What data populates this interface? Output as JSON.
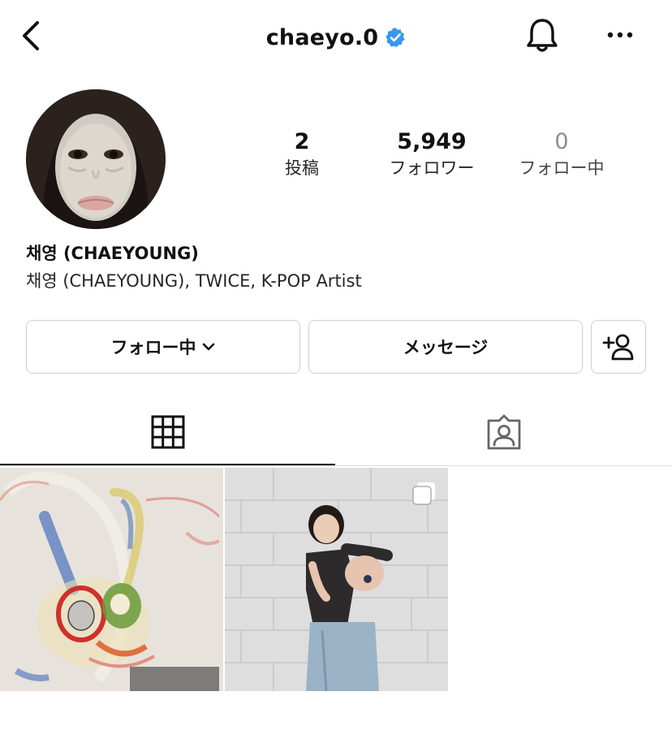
{
  "header": {
    "username": "chaeyo.0",
    "verified": true,
    "back_icon": "chevron-left-icon",
    "notification_icon": "bell-icon",
    "more_icon": "more-horizontal-icon",
    "verified_color": "#3897f0"
  },
  "profile": {
    "display_name": "채영 (CHAEYOUNG)",
    "bio": "채영 (CHAEYOUNG), TWICE, K-POP Artist",
    "avatar_icon": "profile-avatar"
  },
  "stats": [
    {
      "value": "2",
      "label": "投稿"
    },
    {
      "value": "5,949",
      "label": "フォロワー"
    },
    {
      "value": "0",
      "label": "フォロー中"
    }
  ],
  "buttons": {
    "following_label": "フォロー中",
    "message_label": "メッセージ",
    "add_user_icon": "person-add-icon"
  },
  "tabs": [
    {
      "name": "grid",
      "icon": "grid-icon",
      "active": true
    },
    {
      "name": "tagged",
      "icon": "tagged-person-icon",
      "active": false
    }
  ],
  "posts": [
    {
      "description_icon": "drawing-post",
      "multiple": false
    },
    {
      "description_icon": "photo-post",
      "multiple": true
    }
  ]
}
